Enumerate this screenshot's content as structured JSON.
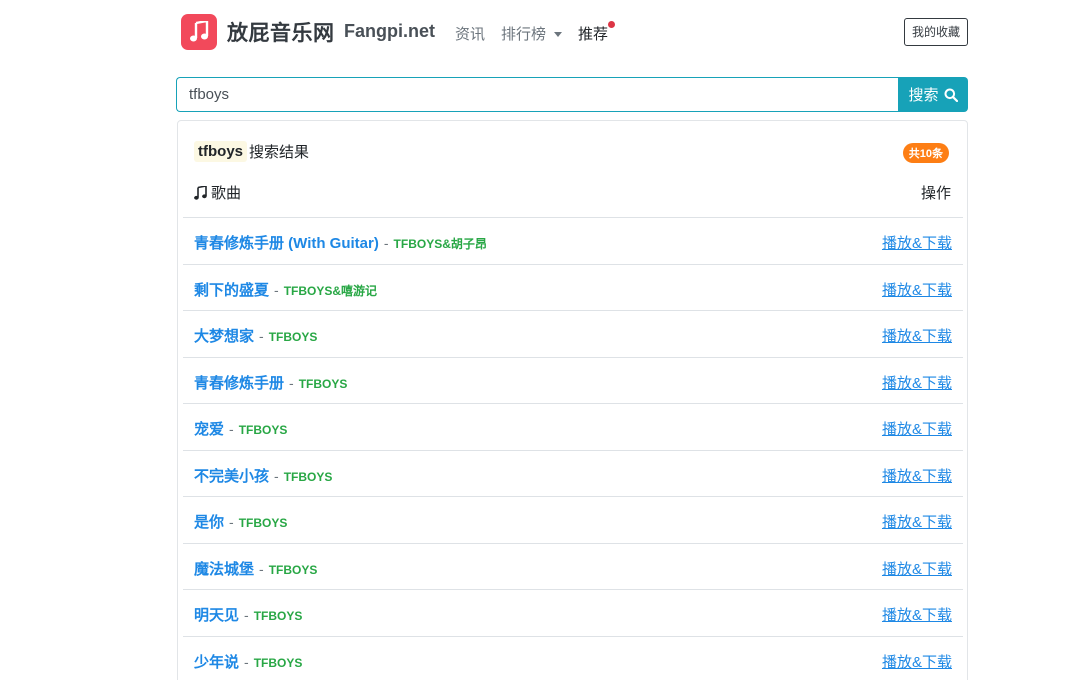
{
  "header": {
    "site_name": "放屁音乐网",
    "site_domain": "Fangpi.net",
    "nav": [
      {
        "label": "资讯"
      },
      {
        "label": "排行榜"
      },
      {
        "label": "推荐"
      }
    ],
    "favorites_label": "我的收藏",
    "logo_icon": "music-note-icon",
    "logo_color": "#f2495b"
  },
  "search": {
    "value": "tfboys",
    "button_label": "搜索",
    "button_icon": "search-icon",
    "accent_color": "#17a2b8"
  },
  "results": {
    "keyword": "tfboys",
    "title_suffix": "搜索结果",
    "count_badge": "共10条",
    "col_song": "歌曲",
    "col_action": "操作",
    "action_label": "播放&下载",
    "songs": [
      {
        "title": "青春修炼手册 (With Guitar)",
        "artist": "TFBOYS&胡子昂"
      },
      {
        "title": "剩下的盛夏",
        "artist": "TFBOYS&嘻游记"
      },
      {
        "title": "大梦想家",
        "artist": "TFBOYS"
      },
      {
        "title": "青春修炼手册",
        "artist": "TFBOYS"
      },
      {
        "title": "宠爱",
        "artist": "TFBOYS"
      },
      {
        "title": "不完美小孩",
        "artist": "TFBOYS"
      },
      {
        "title": "是你",
        "artist": "TFBOYS"
      },
      {
        "title": "魔法城堡",
        "artist": "TFBOYS"
      },
      {
        "title": "明天见",
        "artist": "TFBOYS"
      },
      {
        "title": "少年说",
        "artist": "TFBOYS"
      }
    ]
  }
}
